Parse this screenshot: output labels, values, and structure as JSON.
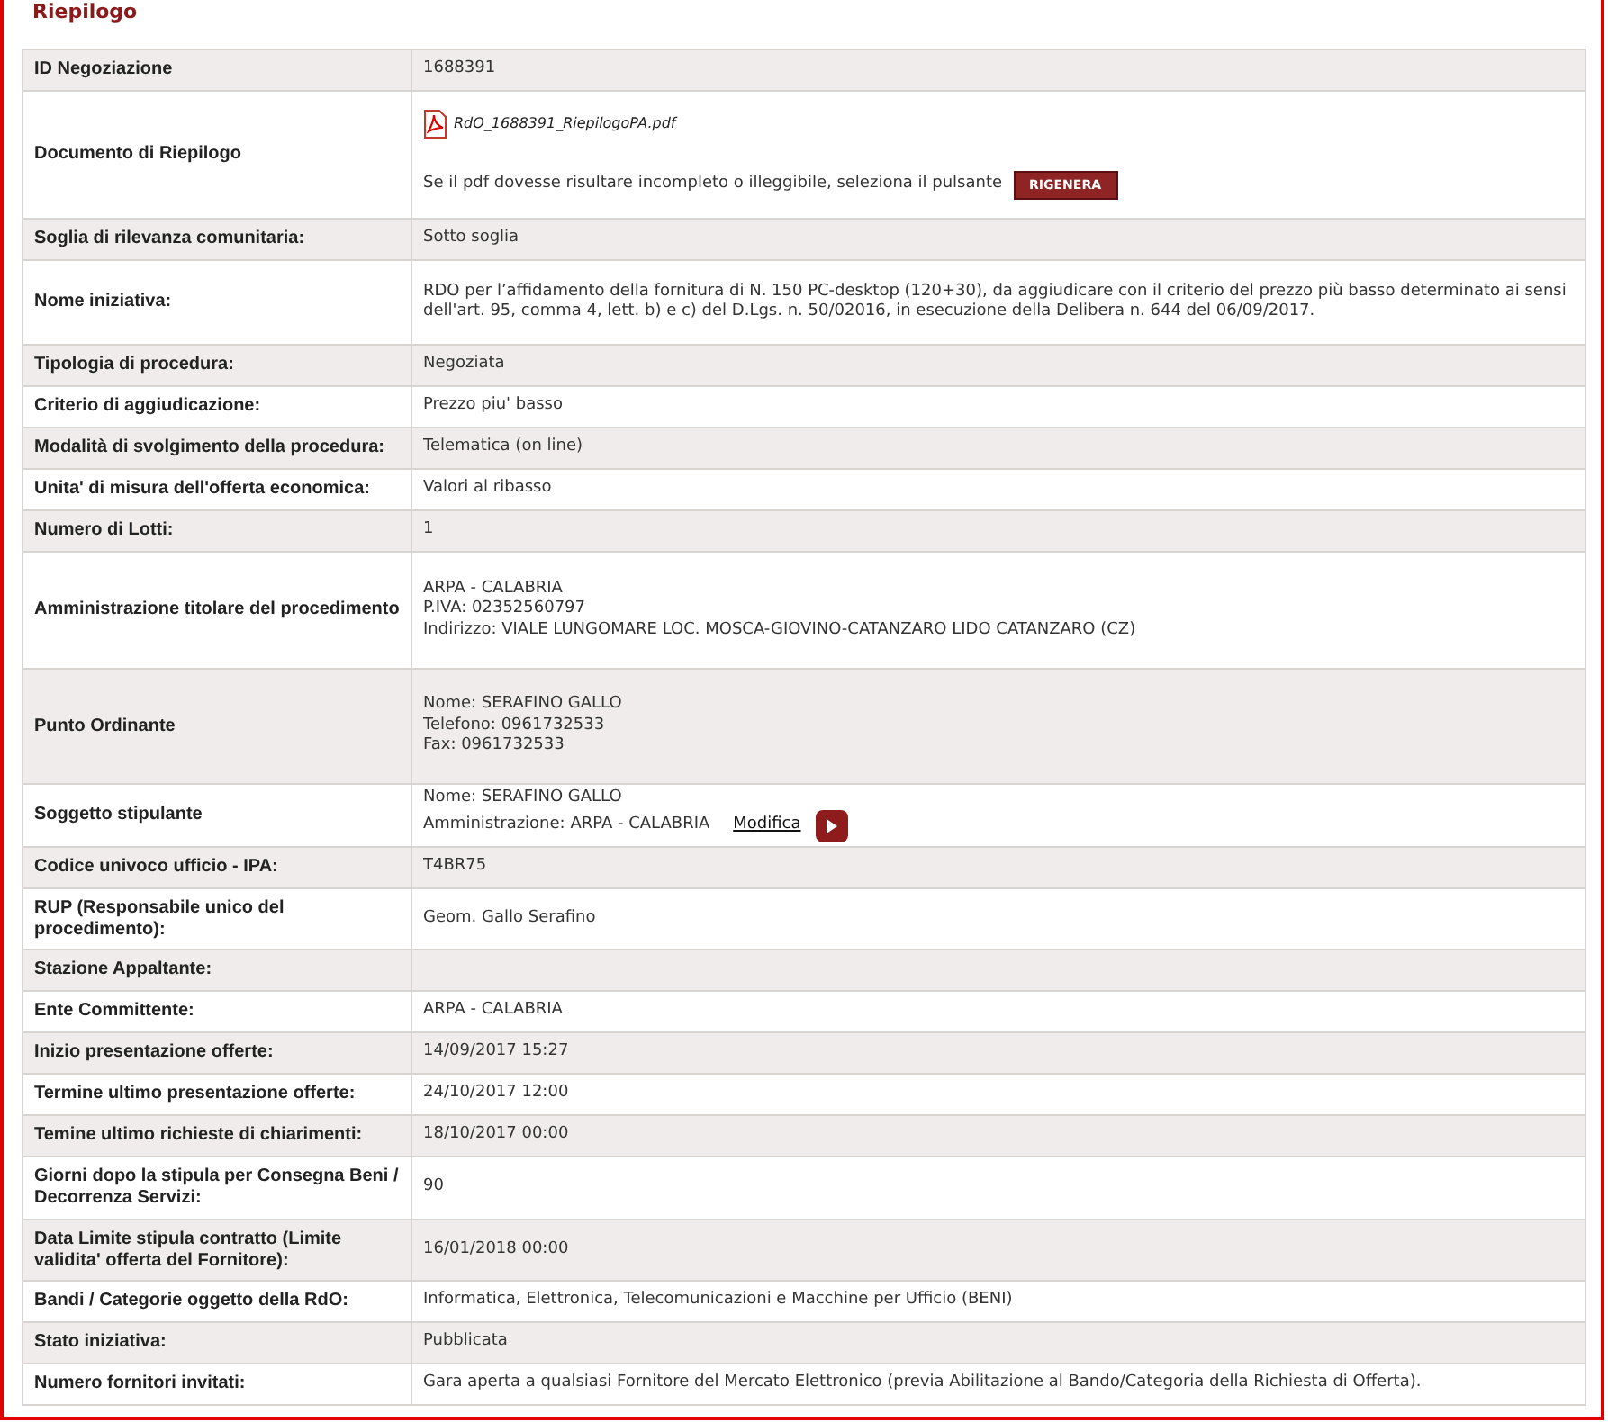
{
  "title": "Riepilogo",
  "rows": [
    {
      "kind": "text",
      "label": "ID Negoziazione",
      "lines": [
        "1688391"
      ]
    },
    {
      "kind": "document",
      "label": "Documento di Riepilogo",
      "file": "RdO_1688391_RiepilogoPA.pdf",
      "note": "Se il pdf dovesse risultare incompleto o illeggibile, seleziona il pulsante",
      "button": "RIGENERA"
    },
    {
      "kind": "text",
      "label": "Soglia di rilevanza comunitaria:",
      "lines": [
        "Sotto soglia"
      ]
    },
    {
      "kind": "text",
      "label": "Nome iniziativa:",
      "lines": [
        "RDO per l’affidamento della fornitura di N. 150 PC-desktop (120+30), da aggiudicare con il criterio del prezzo più basso determinato ai sensi dell'art. 95, comma 4, lett. b) e c) del D.Lgs. n. 50/02016, in esecuzione della Delibera n. 644 del 06/09/2017."
      ]
    },
    {
      "kind": "text",
      "label": "Tipologia di procedura:",
      "lines": [
        "Negoziata"
      ]
    },
    {
      "kind": "text",
      "label": "Criterio di aggiudicazione:",
      "lines": [
        "Prezzo piu' basso"
      ]
    },
    {
      "kind": "text",
      "label": "Modalità di svolgimento della procedura:",
      "lines": [
        "Telematica (on line)"
      ]
    },
    {
      "kind": "text",
      "label": "Unita' di misura dell'offerta economica:",
      "lines": [
        "Valori al ribasso"
      ]
    },
    {
      "kind": "text",
      "label": "Numero di Lotti:",
      "lines": [
        "1"
      ]
    },
    {
      "kind": "text",
      "label": "Amministrazione titolare del procedimento",
      "lines": [
        "ARPA - CALABRIA",
        "P.IVA: 02352560797",
        "Indirizzo: VIALE LUNGOMARE LOC. MOSCA-GIOVINO-CATANZARO LIDO CATANZARO (CZ)"
      ]
    },
    {
      "kind": "text",
      "label": "Punto Ordinante",
      "lines": [
        "Nome: SERAFINO GALLO",
        "Telefono: 0961732533",
        "Fax: 0961732533"
      ]
    },
    {
      "kind": "editable",
      "label": "Soggetto stipulante",
      "lines": [
        "Nome: SERAFINO GALLO",
        "Amministrazione: ARPA - CALABRIA"
      ],
      "link": "Modifica"
    },
    {
      "kind": "text",
      "label": "Codice univoco ufficio - IPA:",
      "lines": [
        "T4BR75"
      ]
    },
    {
      "kind": "text",
      "label": "RUP (Responsabile unico del procedimento):",
      "lines": [
        "Geom. Gallo Serafino"
      ]
    },
    {
      "kind": "text",
      "label": "Stazione Appaltante:",
      "lines": []
    },
    {
      "kind": "text",
      "label": "Ente Committente:",
      "lines": [
        "ARPA - CALABRIA"
      ]
    },
    {
      "kind": "text",
      "label": "Inizio presentazione offerte:",
      "lines": [
        "14/09/2017 15:27"
      ]
    },
    {
      "kind": "text",
      "label": "Termine ultimo presentazione offerte:",
      "lines": [
        "24/10/2017 12:00"
      ]
    },
    {
      "kind": "text",
      "label": "Temine ultimo richieste di chiarimenti:",
      "lines": [
        "18/10/2017 00:00"
      ]
    },
    {
      "kind": "text",
      "label": "Giorni dopo la stipula per Consegna Beni / Decorrenza Servizi:",
      "lines": [
        "90"
      ]
    },
    {
      "kind": "text",
      "label": "Data Limite stipula contratto (Limite validita' offerta del Fornitore):",
      "lines": [
        "16/01/2018 00:00"
      ]
    },
    {
      "kind": "text",
      "label": "Bandi / Categorie oggetto della RdO:",
      "lines": [
        "Informatica, Elettronica, Telecomunicazioni e Macchine per Ufficio (BENI)"
      ]
    },
    {
      "kind": "text",
      "label": "Stato iniziativa:",
      "lines": [
        "Pubblicata"
      ]
    },
    {
      "kind": "text",
      "label": "Numero fornitori invitati:",
      "lines": [
        "Gara aperta a qualsiasi Fornitore del Mercato Elettronico (previa Abilitazione al Bando/Categoria della Richiesta di Offerta)."
      ]
    }
  ]
}
